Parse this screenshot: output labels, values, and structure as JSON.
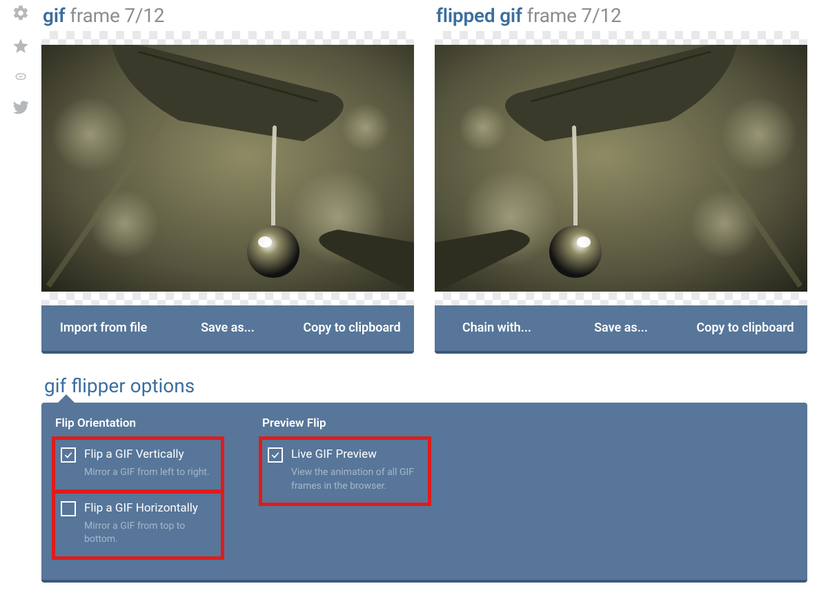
{
  "left_panel": {
    "title_accent": "gif",
    "title_rest": " frame 7/12",
    "buttons": {
      "import": "Import from file",
      "saveas": "Save as...",
      "copy": "Copy to clipboard"
    }
  },
  "right_panel": {
    "title_accent": "flipped gif",
    "title_rest": " frame 7/12",
    "buttons": {
      "chain": "Chain with...",
      "saveas": "Save as...",
      "copy": "Copy to clipboard"
    }
  },
  "options": {
    "title": "gif flipper options",
    "col1": {
      "heading": "Flip Orientation",
      "opt1": {
        "label": "Flip a GIF Vertically",
        "desc": "Mirror a GIF from left to right.",
        "checked": true
      },
      "opt2": {
        "label": "Flip a GIF Horizontally",
        "desc": "Mirror a GIF from top to bottom.",
        "checked": false
      }
    },
    "col2": {
      "heading": "Preview Flip",
      "opt1": {
        "label": "Live GIF Preview",
        "desc": "View the animation of all GIF frames in the browser.",
        "checked": true
      }
    }
  },
  "icons": {
    "gear": "gear-icon",
    "star": "star-icon",
    "link": "link-icon",
    "twitter": "twitter-icon"
  }
}
